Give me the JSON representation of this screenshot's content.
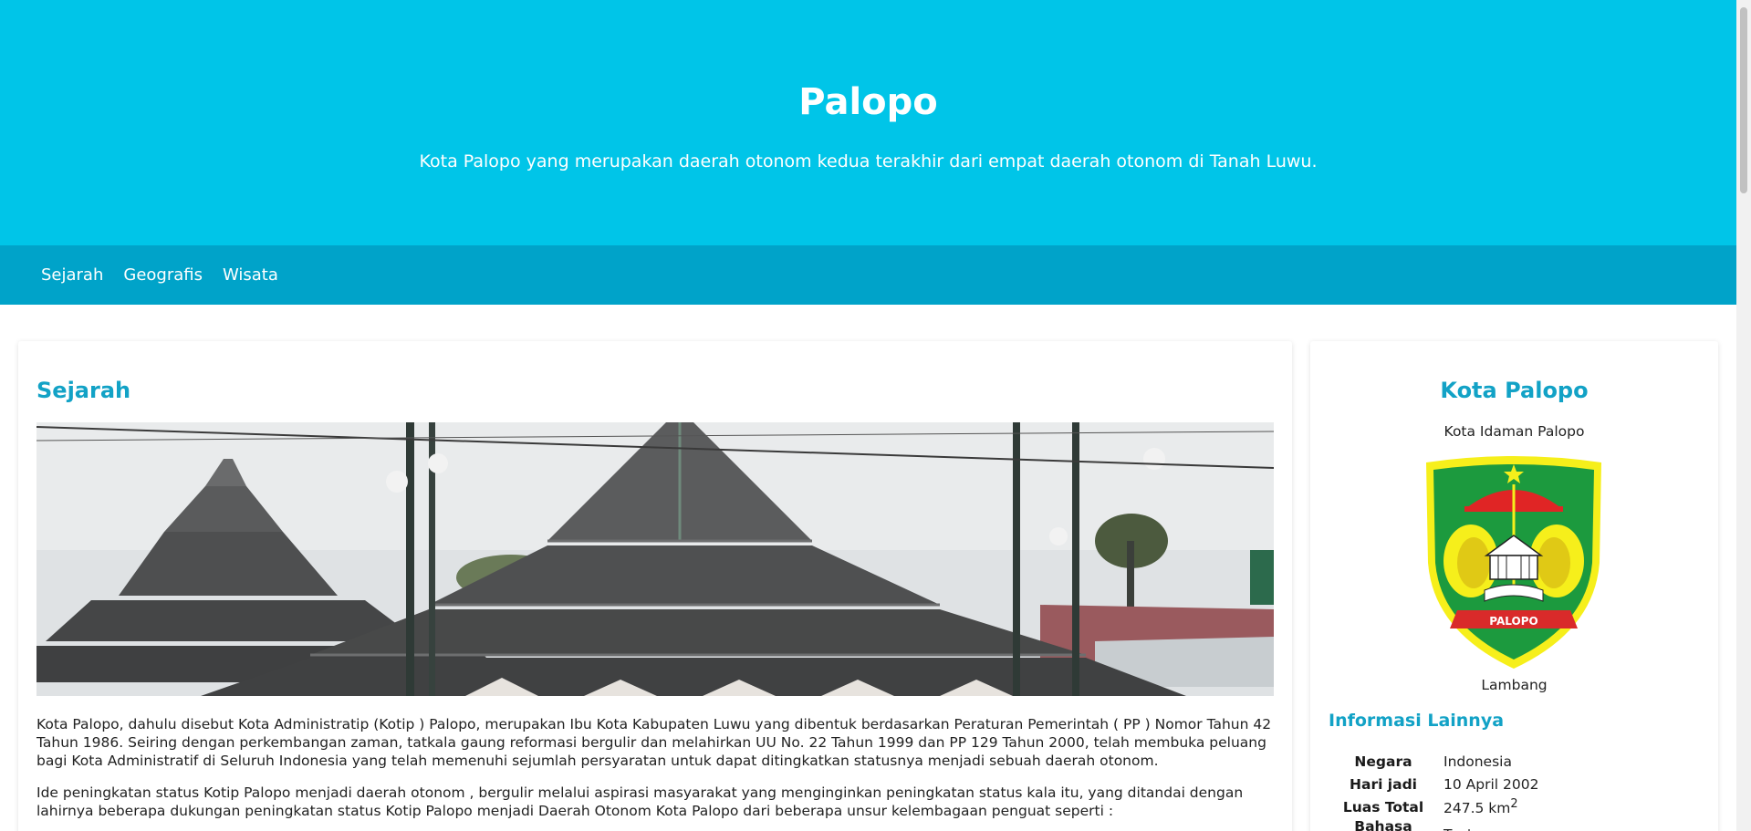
{
  "header": {
    "title": "Palopo",
    "subtitle": "Kota Palopo yang merupakan daerah otonom kedua terakhir dari empat daerah otonom di Tanah Luwu."
  },
  "nav": {
    "items": [
      {
        "label": "Sejarah"
      },
      {
        "label": "Geografis"
      },
      {
        "label": "Wisata"
      }
    ]
  },
  "main": {
    "section_title": "Sejarah",
    "paragraph1": "Kota Palopo, dahulu disebut Kota Administratip (Kotip ) Palopo, merupakan Ibu Kota Kabupaten Luwu yang dibentuk berdasarkan Peraturan Pemerintah ( PP ) Nomor Tahun 42 Tahun 1986. Seiring dengan perkembangan zaman, tatkala gaung reformasi bergulir dan melahirkan UU No. 22 Tahun 1999 dan PP 129 Tahun 2000, telah membuka peluang bagi Kota Administratif di Seluruh Indonesia yang telah memenuhi sejumlah persyaratan untuk dapat ditingkatkan statusnya menjadi sebuah daerah otonom.",
    "paragraph2": "Ide peningkatan status Kotip Palopo menjadi daerah otonom , bergulir melalui aspirasi masyarakat yang menginginkan peningkatan status kala itu, yang ditandai dengan lahirnya beberapa dukungan peningkatan status Kotip Palopo menjadi Daerah Otonom Kota Palopo dari beberapa unsur kelembagaan penguat seperti :"
  },
  "sidebar": {
    "title": "Kota Palopo",
    "motto": "Kota Idaman Palopo",
    "emblem_caption": "Lambang",
    "emblem_text": "PALOPO",
    "info_title": "Informasi Lainnya",
    "info": [
      {
        "key": "Negara",
        "value": "Indonesia"
      },
      {
        "key": "Hari jadi",
        "value": "10 April 2002"
      },
      {
        "key": "Luas Total",
        "value": "247.5 km",
        "sup": "2"
      },
      {
        "key": "Bahasa Daerah",
        "value": "Tae'"
      }
    ]
  },
  "colors": {
    "header_bg": "#00c5e8",
    "nav_bg": "#00a3c9",
    "accent": "#12a2c6"
  }
}
